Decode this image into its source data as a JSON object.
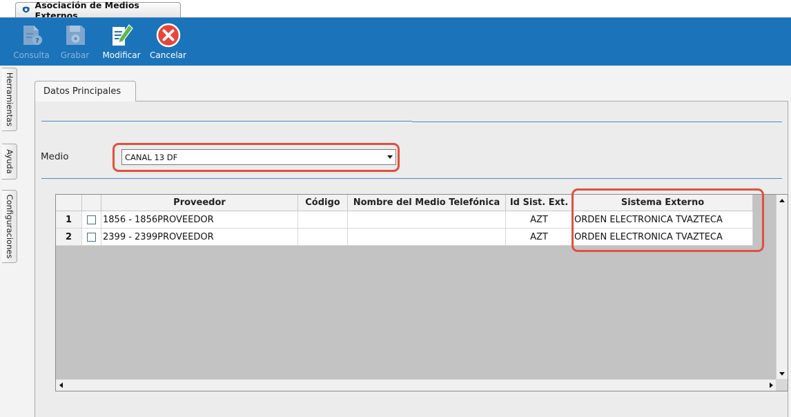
{
  "window": {
    "tab_title": "Asociación de Medios Externos"
  },
  "toolbar": {
    "consulta": "Consulta",
    "grabar": "Grabar",
    "modificar": "Modificar",
    "cancelar": "Cancelar"
  },
  "side_tabs": [
    "Herramientas",
    "Ayuda",
    "Configuraciones"
  ],
  "page_tab": "Datos Principales",
  "medio": {
    "label": "Medio",
    "value": "CANAL 13 DF"
  },
  "grid": {
    "columns": [
      "Proveedor",
      "Código",
      "Nombre del Medio Telefónica",
      "Id Sist. Ext.",
      "Sistema Externo"
    ],
    "rows": [
      {
        "num": "1",
        "proveedor": "1856 - 1856PROVEEDOR",
        "codigo": "",
        "nombre": "",
        "id_sist": "AZT",
        "sistema": "ORDEN ELECTRONICA TVAZTECA"
      },
      {
        "num": "2",
        "proveedor": "2399 - 2399PROVEEDOR",
        "codigo": "",
        "nombre": "",
        "id_sist": "AZT",
        "sistema": "ORDEN ELECTRONICA TVAZTECA"
      }
    ]
  },
  "colors": {
    "toolbar_bg": "#1b73ba",
    "highlight": "#e0503b",
    "separator": "#4a8ac7"
  }
}
